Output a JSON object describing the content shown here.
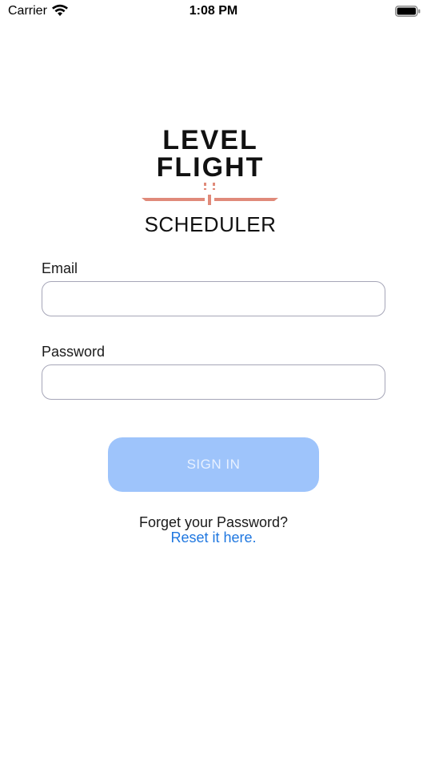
{
  "status_bar": {
    "carrier": "Carrier",
    "time": "1:08 PM",
    "wifi_icon": "wifi-icon",
    "battery_icon": "battery-icon"
  },
  "logo": {
    "line1": "LEVEL",
    "line2": "FLIGHT",
    "line3": "SCHEDULER",
    "accent_color": "#e08a7a"
  },
  "form": {
    "email_label": "Email",
    "email_value": "",
    "password_label": "Password",
    "password_value": ""
  },
  "actions": {
    "sign_in_label": "SIGN IN",
    "sign_in_color": "#9ec4fb",
    "forgot_text": "Forget your Password?",
    "reset_link": "Reset it here.",
    "link_color": "#1f77e0"
  }
}
